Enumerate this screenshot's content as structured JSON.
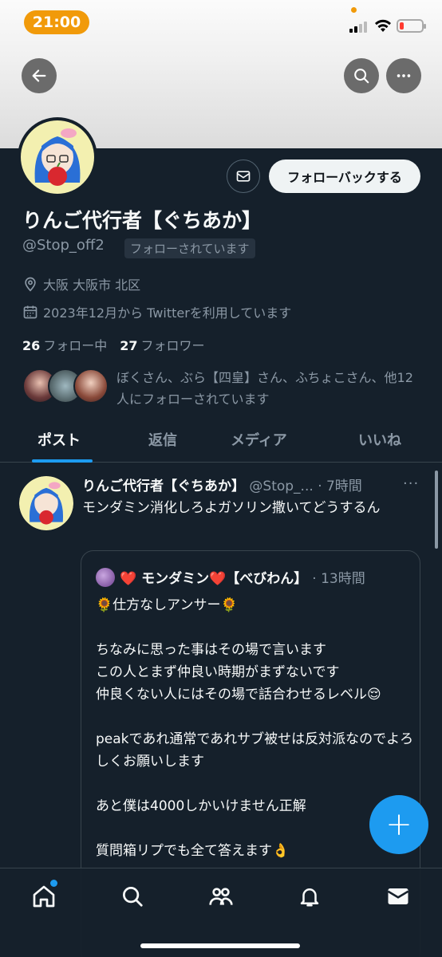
{
  "status_bar": {
    "time": "21:00"
  },
  "profile": {
    "name": "りんご代行者【ぐちあか】",
    "handle": "@Stop_off2",
    "follows_you_badge": "フォローされています",
    "location": "大阪 大阪市 北区",
    "joined": "2023年12月から Twitterを利用しています",
    "following_count": "26",
    "following_label": "フォロー中",
    "followers_count": "27",
    "followers_label": "フォロワー",
    "mutuals_text": "ぼくさん、ぶら【四皇】さん、ふちょこさん、他12人にフォローされています",
    "follow_back_label": "フォローバックする"
  },
  "tabs": [
    {
      "label": "ポスト",
      "active": true
    },
    {
      "label": "返信",
      "active": false
    },
    {
      "label": "メディア",
      "active": false
    },
    {
      "label": "いいね",
      "active": false
    }
  ],
  "post": {
    "author_name": "りんご代行者【ぐちあか】",
    "author_handle": "@Stop_...",
    "time": "· 7時間",
    "more": "···",
    "text": "モンダミン消化しろよガソリン撒いてどうするん",
    "quote": {
      "author_name": "❤️ モンダミン❤️【べびわん】",
      "time": "· 13時間",
      "lines": [
        "🌻仕方なしアンサー🌻",
        "",
        "ちなみに思った事はその場で言います",
        "この人とまず仲良い時期がまずないです",
        "仲良くない人にはその場で話合わせるレベル😌",
        "",
        "peakであれ通常であれサブ被せは反対派なのでよろしくお願いします",
        "",
        "あと僕は4000しかいけません正解",
        "",
        "質問箱リプでも全て答えます👌"
      ]
    }
  },
  "fab_label": "+",
  "bottom_nav": [
    "home-icon",
    "search-icon",
    "communities-icon",
    "notifications-icon",
    "messages-icon"
  ],
  "colors": {
    "background": "#15202b",
    "accent": "#1d9bf0",
    "muted": "#8b98a5",
    "time_pill": "#f19a0a"
  }
}
